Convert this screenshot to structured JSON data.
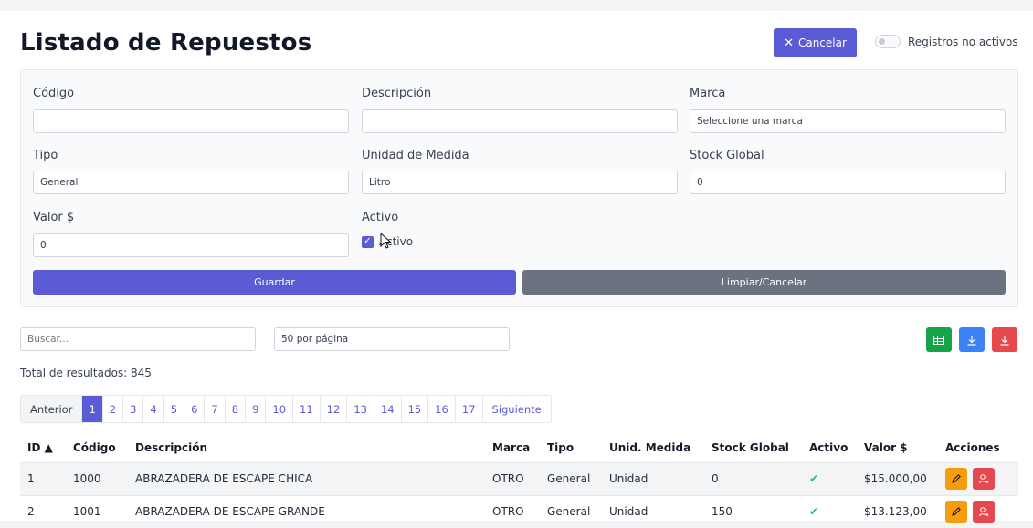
{
  "header": {
    "title": "Listado de Repuestos",
    "cancel_label": "Cancelar",
    "toggle_label": "Registros no activos"
  },
  "form": {
    "codigo_label": "Código",
    "codigo_value": "",
    "descripcion_label": "Descripción",
    "descripcion_value": "",
    "marca_label": "Marca",
    "marca_value": "Seleccione una marca",
    "tipo_label": "Tipo",
    "tipo_value": "General",
    "unidad_label": "Unidad de Medida",
    "unidad_value": "Litro",
    "stock_label": "Stock Global",
    "stock_value": "0",
    "valor_label": "Valor $",
    "valor_value": "0",
    "activo_label": "Activo",
    "activo_checkbox_label": "Activo",
    "activo_checked": true,
    "save_label": "Guardar",
    "clear_label": "Limpiar/Cancelar"
  },
  "list": {
    "search_placeholder": "Buscar...",
    "per_page": "50 por página",
    "total": "Total de resultados: 845",
    "export_buttons": [
      "excel-icon",
      "download-icon",
      "download-icon"
    ],
    "colors": {
      "excel": "#16a34a",
      "csv": "#3b82f6",
      "pdf": "#e5484d"
    }
  },
  "pagination": {
    "prev": "Anterior",
    "pages": [
      "1",
      "2",
      "3",
      "4",
      "5",
      "6",
      "7",
      "8",
      "9",
      "10",
      "11",
      "12",
      "13",
      "14",
      "15",
      "16",
      "17"
    ],
    "active": "1",
    "next": "Siguiente"
  },
  "table": {
    "columns": [
      "ID ▲",
      "Código",
      "Descripción",
      "Marca",
      "Tipo",
      "Unid. Medida",
      "Stock Global",
      "Activo",
      "Valor $",
      "Acciones"
    ],
    "rows": [
      {
        "id": "1",
        "codigo": "1000",
        "descripcion": "ABRAZADERA DE ESCAPE CHICA",
        "marca": "OTRO",
        "tipo": "General",
        "unidad": "Unidad",
        "stock": "0",
        "activo": true,
        "valor": "$15.000,00"
      },
      {
        "id": "2",
        "codigo": "1001",
        "descripcion": "ABRAZADERA DE ESCAPE GRANDE",
        "marca": "OTRO",
        "tipo": "General",
        "unidad": "Unidad",
        "stock": "150",
        "activo": true,
        "valor": "$13.123,00"
      }
    ]
  },
  "theme": {
    "primary": "#5b5bd6",
    "secondary": "#6b7280",
    "warning": "#f59e0b",
    "danger": "#e5484d",
    "success": "#22c55e"
  }
}
